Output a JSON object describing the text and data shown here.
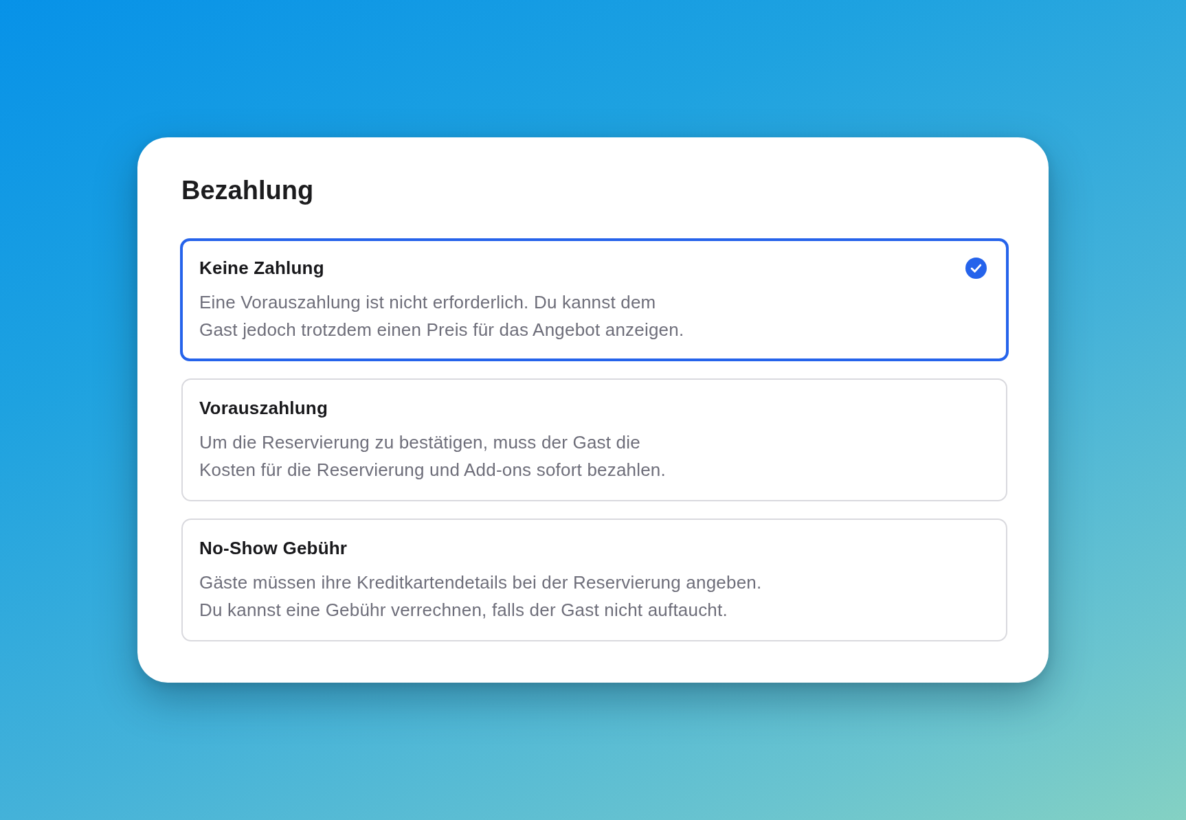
{
  "card": {
    "title": "Bezahlung",
    "options": [
      {
        "title": "Keine Zahlung",
        "description": "Eine Vorauszahlung ist nicht erforderlich. Du kannst dem\nGast jedoch trotzdem einen Preis für das Angebot anzeigen.",
        "selected": true
      },
      {
        "title": "Vorauszahlung",
        "description": "Um die Reservierung zu bestätigen, muss der Gast die\nKosten für die Reservierung und Add-ons sofort bezahlen.",
        "selected": false
      },
      {
        "title": "No-Show Gebühr",
        "description": "Gäste müssen ihre Kreditkartendetails bei der Reservierung angeben.\nDu kannst eine Gebühr verrechnen, falls der Gast nicht auftaucht.",
        "selected": false
      }
    ]
  }
}
